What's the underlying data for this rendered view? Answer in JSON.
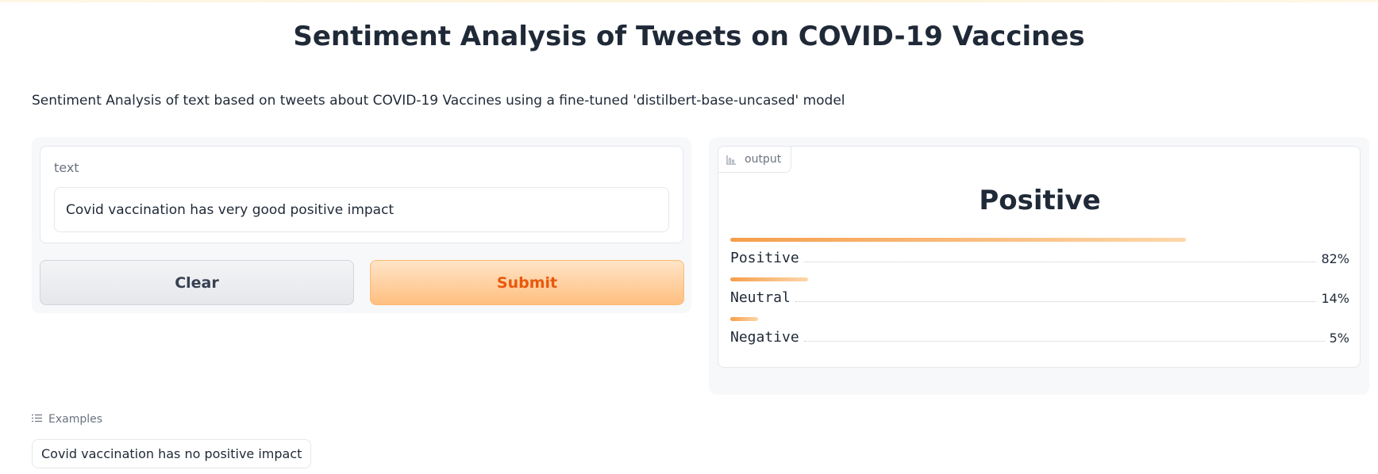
{
  "header": {
    "title": "Sentiment Analysis of Tweets on COVID-19 Vaccines",
    "description": "Sentiment Analysis of text based on tweets about COVID-19 Vaccines using a fine-tuned 'distilbert-base-uncased' model"
  },
  "input": {
    "label": "text",
    "value": "Covid vaccination has very good positive impact",
    "clear_label": "Clear",
    "submit_label": "Submit"
  },
  "output": {
    "tag_label": "output",
    "tag_icon": "bar-chart-icon",
    "predicted_label": "Positive",
    "confidences": [
      {
        "label": "Positive",
        "value": 0.82,
        "display": "82%"
      },
      {
        "label": "Neutral",
        "value": 0.14,
        "display": "14%"
      },
      {
        "label": "Negative",
        "value": 0.05,
        "display": "5%"
      }
    ]
  },
  "examples": {
    "header_label": "Examples",
    "header_icon": "list-icon",
    "items": [
      "Covid vaccination has no positive impact"
    ]
  },
  "colors": {
    "accent": "#ea580c",
    "bar_start": "#f59e4b",
    "bar_end": "#fed7aa"
  }
}
